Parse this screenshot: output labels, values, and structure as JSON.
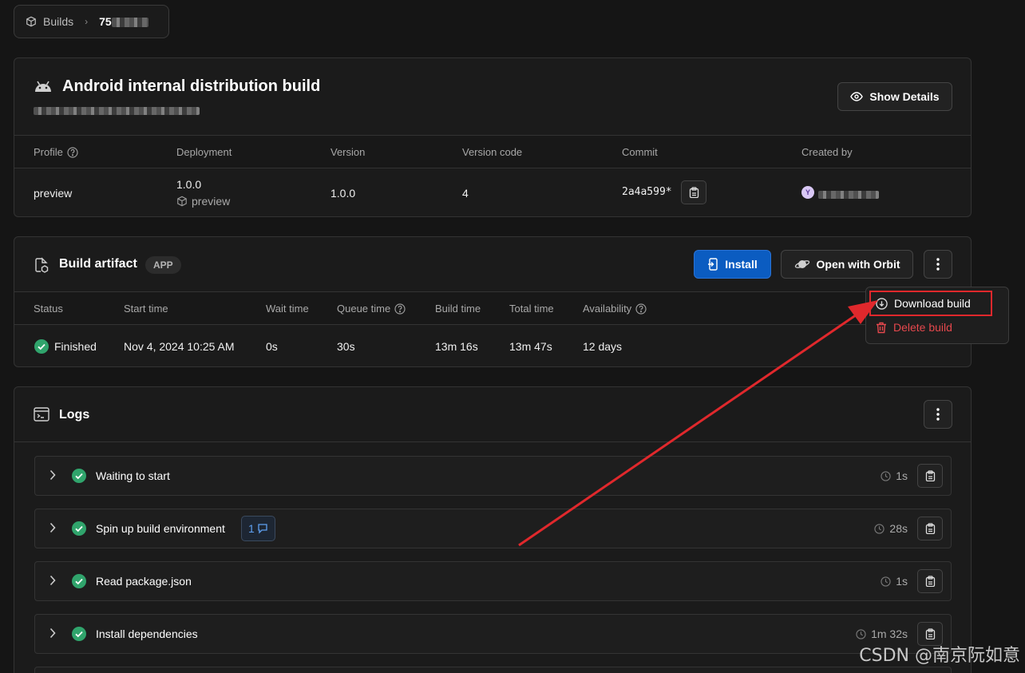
{
  "breadcrumb": {
    "root": "Builds",
    "current": "75"
  },
  "build": {
    "title": "Android internal distribution build",
    "show_details": "Show Details",
    "headers": {
      "profile": "Profile",
      "deployment": "Deployment",
      "version": "Version",
      "version_code": "Version code",
      "commit": "Commit",
      "created_by": "Created by"
    },
    "values": {
      "profile": "preview",
      "deployment_version": "1.0.0",
      "deployment_channel": "preview",
      "version": "1.0.0",
      "version_code": "4",
      "commit": "2a4a599*",
      "avatar_letter": "Y"
    }
  },
  "artifact": {
    "title": "Build artifact",
    "badge": "APP",
    "install": "Install",
    "open_orbit": "Open with Orbit",
    "headers": {
      "status": "Status",
      "start_time": "Start time",
      "wait_time": "Wait time",
      "queue_time": "Queue time",
      "build_time": "Build time",
      "total_time": "Total time",
      "availability": "Availability"
    },
    "values": {
      "status": "Finished",
      "start_time": "Nov 4, 2024 10:25 AM",
      "wait_time": "0s",
      "queue_time": "30s",
      "build_time": "13m 16s",
      "total_time": "13m 47s",
      "availability": "12 days"
    }
  },
  "menu": {
    "download": "Download build",
    "delete": "Delete build"
  },
  "logs": {
    "title": "Logs",
    "steps": [
      {
        "label": "Waiting to start",
        "time": "1s"
      },
      {
        "label": "Spin up build environment",
        "time": "28s",
        "badge": "1"
      },
      {
        "label": "Read package.json",
        "time": "1s"
      },
      {
        "label": "Install dependencies",
        "time": "1m 32s"
      }
    ]
  },
  "watermark": "CSDN @南京阮如意",
  "colors": {
    "accent": "#0b5cc1",
    "success": "#30a46c",
    "danger": "#e5484d",
    "annotation": "#e0282c"
  }
}
